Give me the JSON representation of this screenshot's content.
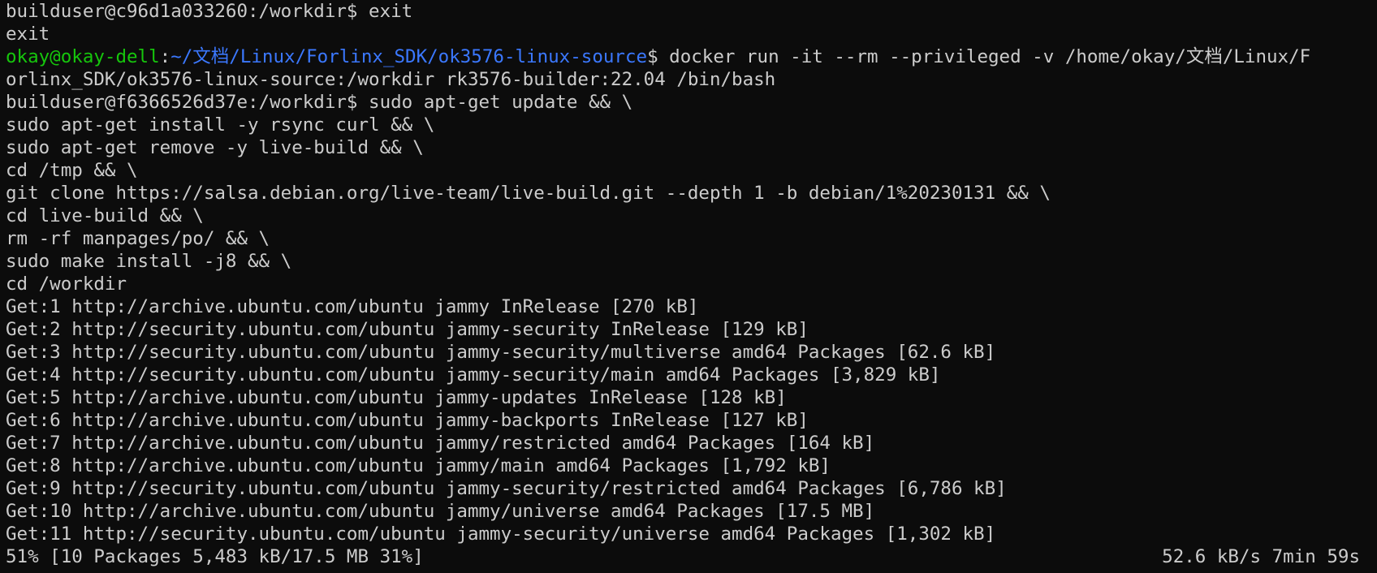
{
  "colors": {
    "background": "#0c0c0c",
    "text": "#cccccc",
    "prompt_user": "#16c60c",
    "prompt_path": "#3b78ff"
  },
  "lines": [
    "builduser@c96d1a033260:/workdir$ exit",
    "exit"
  ],
  "prompt": {
    "user_host": "okay@okay-dell",
    "colon": ":",
    "path": "~/文档/Linux/Forlinx_SDK/ok3576-linux-source",
    "command": "$ docker run -it --rm --privileged -v /home/okay/文档/Linux/F"
  },
  "lines2": [
    "orlinx_SDK/ok3576-linux-source:/workdir rk3576-builder:22.04 /bin/bash",
    "builduser@f6366526d37e:/workdir$ sudo apt-get update && \\",
    "sudo apt-get install -y rsync curl && \\",
    "sudo apt-get remove -y live-build && \\",
    "cd /tmp && \\",
    "git clone https://salsa.debian.org/live-team/live-build.git --depth 1 -b debian/1%20230131 && \\",
    "cd live-build && \\",
    "rm -rf manpages/po/ && \\",
    "sudo make install -j8 && \\",
    "cd /workdir",
    "Get:1 http://archive.ubuntu.com/ubuntu jammy InRelease [270 kB]",
    "Get:2 http://security.ubuntu.com/ubuntu jammy-security InRelease [129 kB]",
    "Get:3 http://security.ubuntu.com/ubuntu jammy-security/multiverse amd64 Packages [62.6 kB]",
    "Get:4 http://security.ubuntu.com/ubuntu jammy-security/main amd64 Packages [3,829 kB]",
    "Get:5 http://archive.ubuntu.com/ubuntu jammy-updates InRelease [128 kB]",
    "Get:6 http://archive.ubuntu.com/ubuntu jammy-backports InRelease [127 kB]",
    "Get:7 http://archive.ubuntu.com/ubuntu jammy/restricted amd64 Packages [164 kB]",
    "Get:8 http://archive.ubuntu.com/ubuntu jammy/main amd64 Packages [1,792 kB]",
    "Get:9 http://security.ubuntu.com/ubuntu jammy-security/restricted amd64 Packages [6,786 kB]",
    "Get:10 http://archive.ubuntu.com/ubuntu jammy/universe amd64 Packages [17.5 MB]",
    "Get:11 http://security.ubuntu.com/ubuntu jammy-security/universe amd64 Packages [1,302 kB]"
  ],
  "status": {
    "progress": "51% [10 Packages 5,483 kB/17.5 MB 31%]",
    "rate": "52.6 kB/s 7min 59s"
  }
}
